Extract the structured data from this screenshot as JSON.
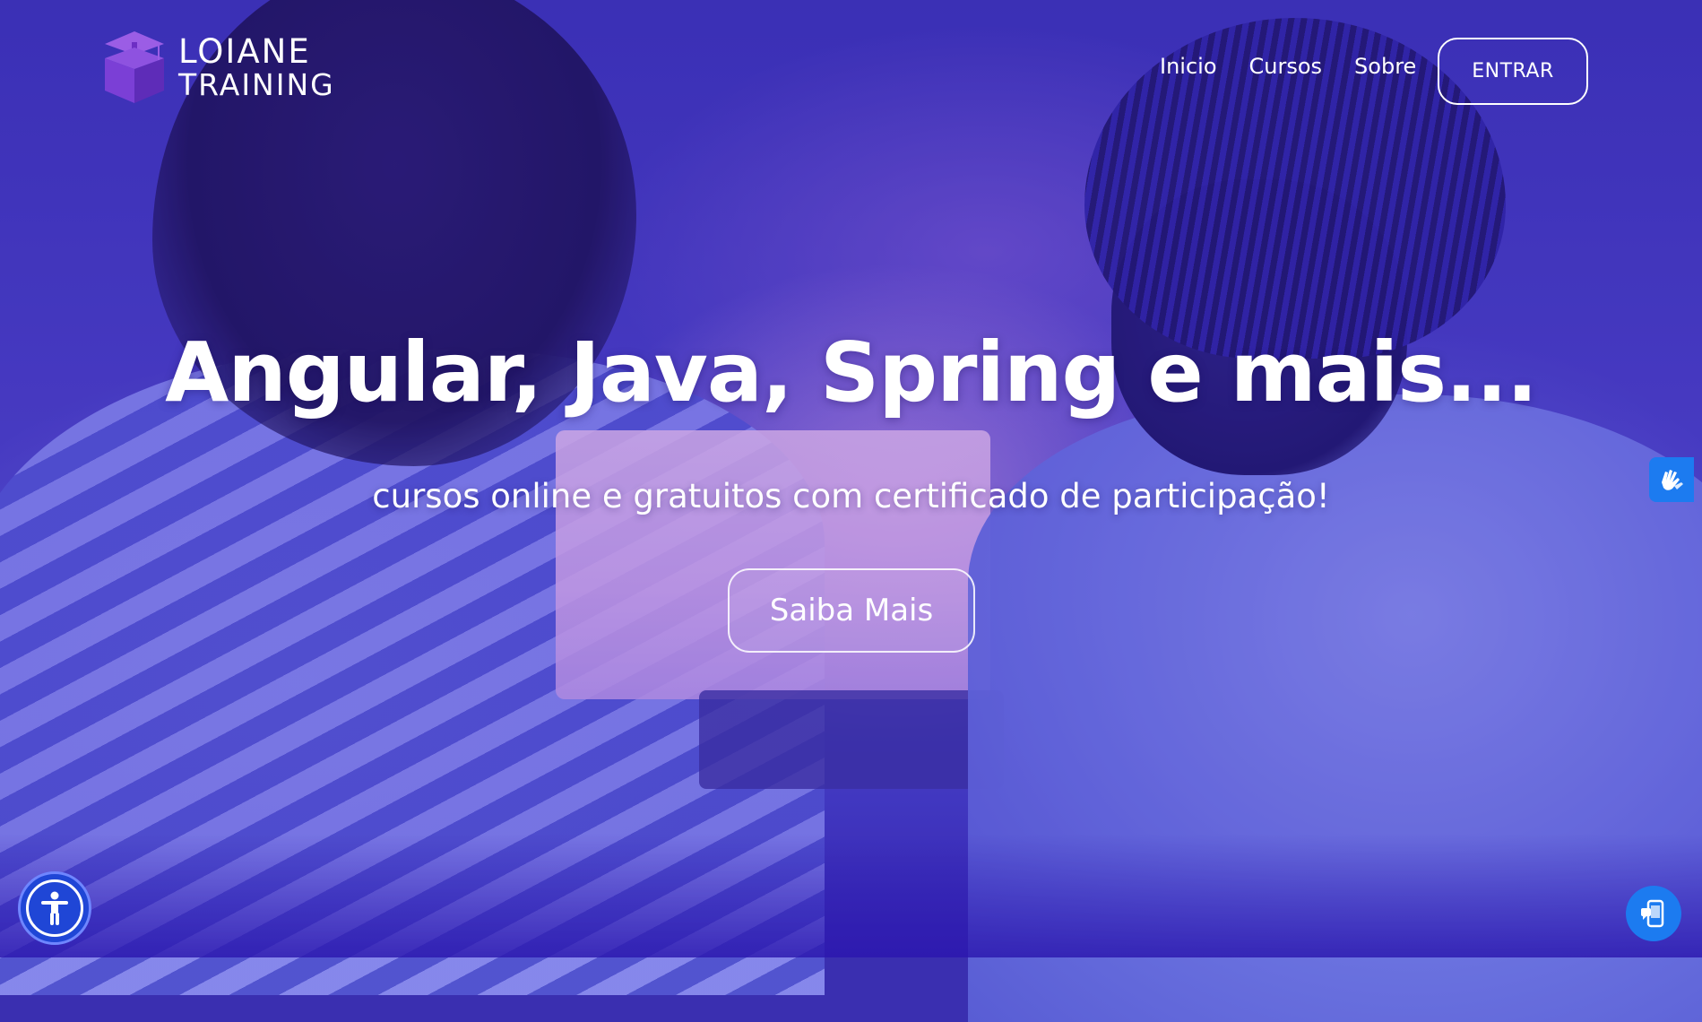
{
  "brand": {
    "name_line1": "LOIANE",
    "name_line2": "TRAINING",
    "logo_icon": "graduation-cap-box-logo",
    "logo_color": "#7b3fd6"
  },
  "nav": {
    "items": [
      {
        "label": "Inicio"
      },
      {
        "label": "Cursos"
      },
      {
        "label": "Sobre"
      }
    ],
    "cta_label": "ENTRAR"
  },
  "hero": {
    "title": "Angular, Java, Spring e mais...",
    "subtitle": "cursos online e gratuitos com certificado de participação!",
    "button_label": "Saiba Mais"
  },
  "widgets": {
    "accessibility_icon": "accessibility-person-icon",
    "sign_language_icon": "sign-language-hands-icon",
    "chat_icon": "phone-chat-icon",
    "accent_color": "#1c7bf0"
  },
  "colors": {
    "overlay": "#3a28be",
    "text": "#ffffff"
  }
}
